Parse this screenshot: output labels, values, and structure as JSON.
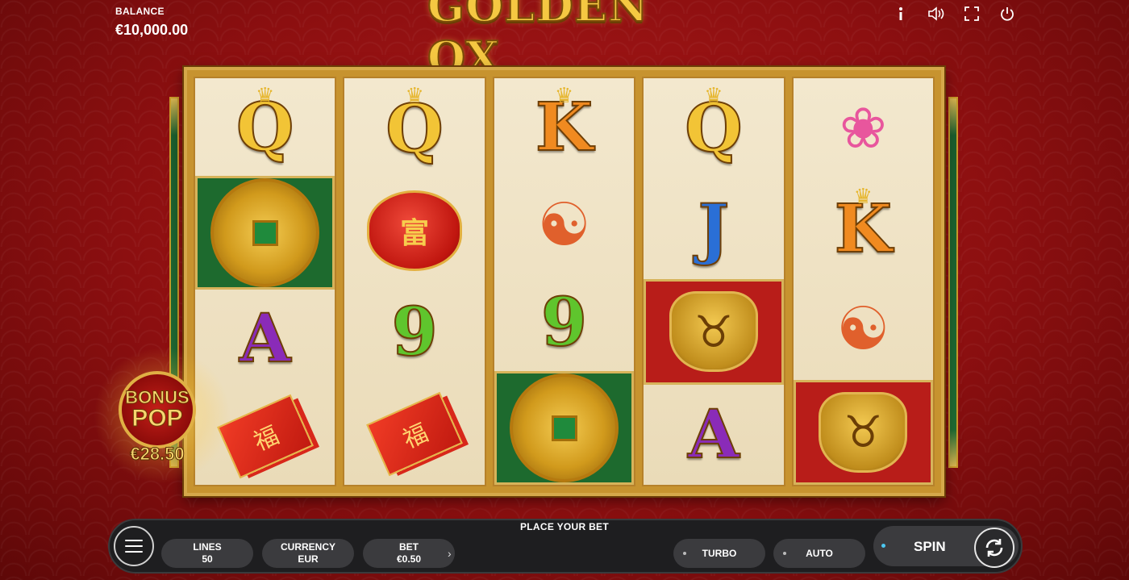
{
  "header": {
    "balance_label": "BALANCE",
    "balance_value": "€10,000.00",
    "logo_text": "GOLDEN OX",
    "icons": [
      "info-icon",
      "sound-icon",
      "fullscreen-icon",
      "power-icon"
    ]
  },
  "reels": [
    [
      "queen",
      "gold-coin",
      "ace",
      "red-envelopes"
    ],
    [
      "queen",
      "red-lantern",
      "nine",
      "red-envelopes"
    ],
    [
      "king",
      "koi-fish",
      "nine",
      "gold-coin"
    ],
    [
      "queen",
      "jack",
      "golden-ox",
      "ace"
    ],
    [
      "lotus",
      "king",
      "koi-fish",
      "golden-ox"
    ]
  ],
  "symbols": {
    "queen": "Q",
    "king": "K",
    "ace": "A",
    "jack": "J",
    "nine": "9",
    "lantern_char": "富",
    "envelope_char": "福"
  },
  "bonus_pop": {
    "line1": "BONUS",
    "line2": "POP",
    "amount": "€28.50"
  },
  "controls": {
    "place_bet": "PLACE YOUR BET",
    "lines_label": "LINES",
    "lines_value": "50",
    "currency_label": "CURRENCY",
    "currency_value": "EUR",
    "bet_label": "BET",
    "bet_value": "€0.50",
    "turbo_label": "TURBO",
    "auto_label": "AUTO",
    "spin_label": "SPIN"
  },
  "colors": {
    "background": "#a51616",
    "gold": "#f5c842",
    "panel": "#1e1e20",
    "pill": "#3b3b3e"
  }
}
